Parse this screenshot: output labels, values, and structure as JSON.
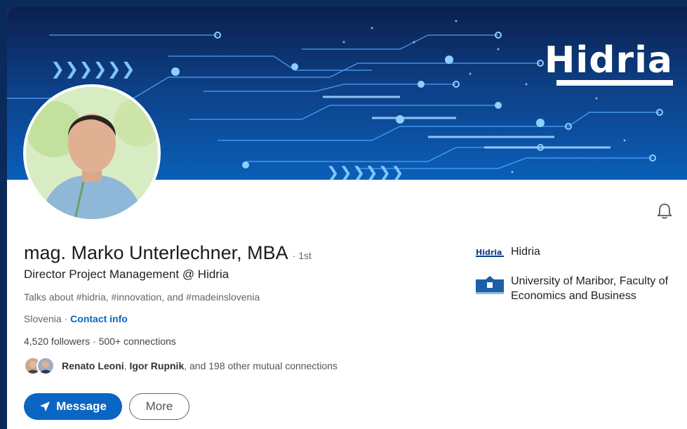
{
  "profile": {
    "name": "mag. Marko Unterlechner, MBA",
    "degree": "· 1st",
    "headline": "Director Project Management @ Hidria",
    "talks_about": "Talks about #hidria, #innovation, and #madeinslovenia",
    "location": "Slovenia ·",
    "contact_info": "Contact info",
    "followers": "4,520 followers",
    "connections_sep": " · ",
    "connections": "500+ connections",
    "mutual": {
      "name1": "Renato Leoni",
      "sep": ", ",
      "name2": "Igor Rupnik",
      "rest": ", and 198 other mutual connections"
    }
  },
  "banner": {
    "brand": "Hidria"
  },
  "actions": {
    "message_label": "Message",
    "more_label": "More"
  },
  "experience": [
    {
      "name": "Hidria",
      "logo": "hidria-logo"
    },
    {
      "name": "University of Maribor, Faculty of Economics and Business",
      "logo": "university-logo"
    }
  ],
  "icons": {
    "bell": "bell-icon",
    "send": "paper-plane-icon"
  },
  "colors": {
    "primary": "#0a66c2",
    "page_bg": "#0a2a5c",
    "banner": "#0d3f85"
  }
}
